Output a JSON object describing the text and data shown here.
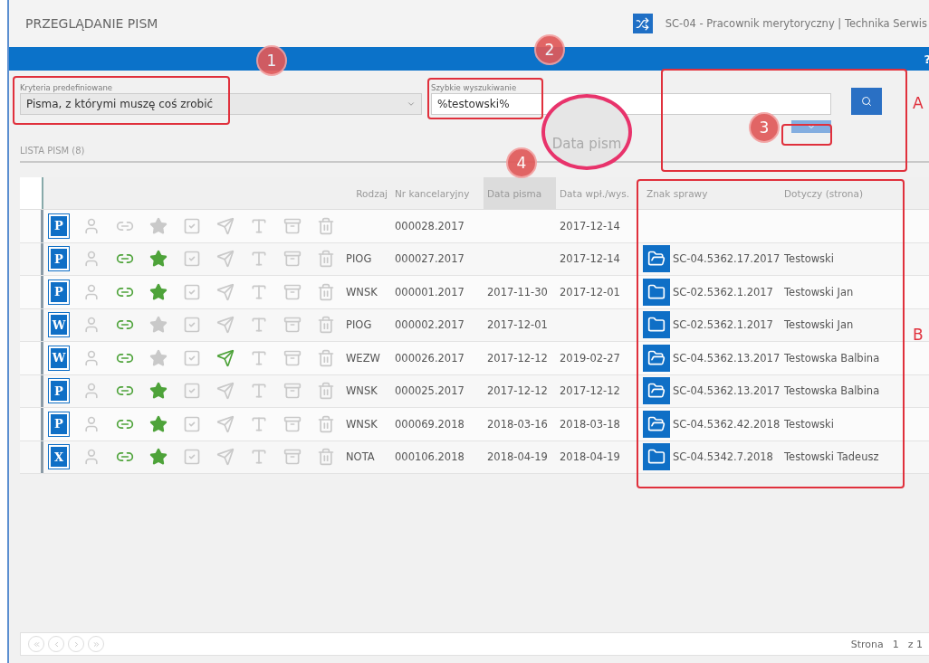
{
  "header": {
    "title": "PRZEGLĄDANIE PISM",
    "user": "SC-04 - Pracownik merytoryczny | Technika Serwis",
    "help": "?"
  },
  "filters": {
    "criteria": {
      "label": "Kryteria predefiniowane",
      "value": "Pisma, z którymi muszę coś zrobić"
    },
    "quick_search": {
      "label": "Szybkie wyszukiwanie",
      "value": "%testowski%"
    }
  },
  "list": {
    "title": "LISTA PISM (8)",
    "columns": [
      {
        "label": "Rodzaj",
        "selected": false
      },
      {
        "label": "Nr kancelaryjny",
        "selected": false
      },
      {
        "label": "Data pisma",
        "selected": true
      },
      {
        "label": "Data wpł./wys.",
        "selected": false
      },
      {
        "label": "Znak sprawy",
        "selected": false
      },
      {
        "label": "Dotyczy (strona)",
        "selected": false
      }
    ],
    "rows": [
      {
        "doc_letter": "P",
        "linked": false,
        "starred": false,
        "sent": false,
        "rodzaj": "",
        "nr": "000028.2017",
        "data_pisma": "",
        "data_wpl": "2017-12-14",
        "znak": "",
        "dotyczy": ""
      },
      {
        "doc_letter": "P",
        "linked": true,
        "starred": true,
        "sent": false,
        "rodzaj": "PIOG",
        "nr": "000027.2017",
        "data_pisma": "",
        "data_wpl": "2017-12-14",
        "folder_open": true,
        "znak": "SC-04.5362.17.2017",
        "dotyczy": "Testowski"
      },
      {
        "doc_letter": "P",
        "linked": true,
        "starred": true,
        "sent": false,
        "rodzaj": "WNSK",
        "nr": "000001.2017",
        "data_pisma": "2017-11-30",
        "data_wpl": "2017-12-01",
        "folder_open": false,
        "znak": "SC-02.5362.1.2017",
        "dotyczy": "Testowski Jan"
      },
      {
        "doc_letter": "W",
        "linked": true,
        "starred": false,
        "sent": false,
        "rodzaj": "PIOG",
        "nr": "000002.2017",
        "data_pisma": "2017-12-01",
        "data_wpl": "",
        "folder_open": false,
        "znak": "SC-02.5362.1.2017",
        "dotyczy": "Testowski Jan"
      },
      {
        "doc_letter": "W",
        "linked": true,
        "starred": false,
        "sent": true,
        "rodzaj": "WEZW",
        "nr": "000026.2017",
        "data_pisma": "2017-12-12",
        "data_wpl": "2019-02-27",
        "folder_open": true,
        "znak": "SC-04.5362.13.2017",
        "dotyczy": "Testowska Balbina"
      },
      {
        "doc_letter": "P",
        "linked": true,
        "starred": true,
        "sent": false,
        "rodzaj": "WNSK",
        "nr": "000025.2017",
        "data_pisma": "2017-12-12",
        "data_wpl": "2017-12-12",
        "folder_open": true,
        "znak": "SC-04.5362.13.2017",
        "dotyczy": "Testowska Balbina"
      },
      {
        "doc_letter": "P",
        "linked": true,
        "starred": true,
        "sent": false,
        "rodzaj": "WNSK",
        "nr": "000069.2018",
        "data_pisma": "2018-03-16",
        "data_wpl": "2018-03-18",
        "folder_open": true,
        "znak": "SC-04.5362.42.2018",
        "dotyczy": "Testowski"
      },
      {
        "doc_letter": "X",
        "linked": true,
        "starred": true,
        "sent": false,
        "rodzaj": "NOTA",
        "nr": "000106.2018",
        "data_pisma": "2018-04-19",
        "data_wpl": "2018-04-19",
        "folder_open": false,
        "znak": "SC-04.5342.7.2018",
        "dotyczy": "Testowski Tadeusz"
      }
    ]
  },
  "pager": {
    "label": "Strona",
    "page": "1",
    "total": "z 1"
  },
  "annotations": {
    "markers": [
      "1",
      "2",
      "3",
      "4"
    ],
    "brackets": [
      "A",
      "B"
    ],
    "magnifier_text": "Data pism"
  }
}
